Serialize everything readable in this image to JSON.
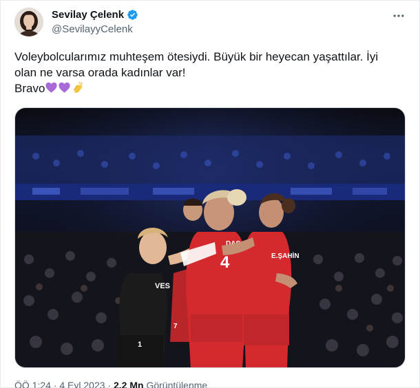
{
  "author": {
    "display_name": "Sevilay Çelenk",
    "handle": "@SevilayyCelenk",
    "verified": true
  },
  "tweet": {
    "line1": "Voleybolcularımız muhteşem ötesiydi. Büyük bir heyecan yaşattılar. İyi olan ne varsa orada kadınlar var!",
    "line2": "Bravo",
    "emojis": [
      "purple-heart",
      "purple-heart",
      "clapping-hands"
    ]
  },
  "media": {
    "jersey_names": [
      "DAS",
      "E.ŞAHİN",
      "VES"
    ],
    "jersey_numbers": [
      "4",
      "1",
      "7"
    ],
    "colors": {
      "kit_red": "#d42a2e",
      "kit_black": "#1b1b1b",
      "crowd_blue": "#1e3a8a"
    }
  },
  "meta": {
    "time": "ÖÖ 1:24",
    "separator": "·",
    "date": "4 Eyl 2023",
    "views_count": "2,2 Mn",
    "views_label": "Görüntülenme"
  },
  "icons": [
    "verified-badge-icon",
    "more-options-icon"
  ]
}
